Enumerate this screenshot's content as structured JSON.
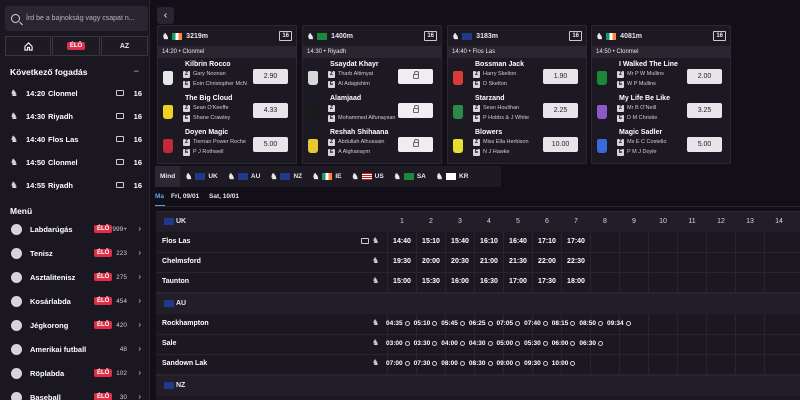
{
  "search": {
    "placeholder": "Írd be a bajnokság vagy csapat n..."
  },
  "segments": {
    "home": "home",
    "live": "ÉLŐ",
    "az": "AZ"
  },
  "next_bets": {
    "title": "Következő fogadás",
    "collapse": "−",
    "items": [
      {
        "time": "14:20",
        "track": "Clonmel",
        "count": "16",
        "icon": "tv-icon"
      },
      {
        "time": "14:30",
        "track": "Riyadh",
        "count": "16",
        "icon": "tv-icon"
      },
      {
        "time": "14:40",
        "track": "Flos Las",
        "count": "16",
        "icon": "tv-icon"
      },
      {
        "time": "14:50",
        "track": "Clonmel",
        "count": "16",
        "icon": "tv-icon"
      },
      {
        "time": "14:55",
        "track": "Riyadh",
        "count": "16",
        "icon": "tv-icon"
      }
    ]
  },
  "menu": {
    "title": "Menü",
    "items": [
      {
        "name": "Labdarúgás",
        "live": "ÉLŐ",
        "count": "999+"
      },
      {
        "name": "Tenisz",
        "live": "ÉLŐ",
        "count": "223"
      },
      {
        "name": "Asztalitenisz",
        "live": "ÉLŐ",
        "count": "275"
      },
      {
        "name": "Kosárlabda",
        "live": "ÉLŐ",
        "count": "454"
      },
      {
        "name": "Jégkorong",
        "live": "ÉLŐ",
        "count": "420"
      },
      {
        "name": "Amerikai futball",
        "live": "",
        "count": "48"
      },
      {
        "name": "Röplabda",
        "live": "ÉLŐ",
        "count": "102"
      },
      {
        "name": "Baseball",
        "live": "ÉLŐ",
        "count": "30"
      }
    ]
  },
  "cards": [
    {
      "distance": "3219m",
      "count": "16",
      "flag": "ie",
      "sub": "14:20 • Clonmel",
      "runners": [
        {
          "name": "Kilbrin Rocco",
          "z": "Gary Noonan",
          "e": "Eoin Christopher McN",
          "odds": "2.90",
          "silk": "#e8e8e8"
        },
        {
          "name": "The Big Cloud",
          "z": "Sean O'Keeffe",
          "e": "Shane Crawley",
          "odds": "4.33",
          "silk": "#f0d020"
        },
        {
          "name": "Doyen Magic",
          "z": "Tiernan Power Roche",
          "e": "P J Rothwell",
          "odds": "5.00",
          "silk": "#c02a3a"
        }
      ]
    },
    {
      "distance": "1400m",
      "count": "16",
      "flag": "sa",
      "sub": "14:30 • Riyadh",
      "runners": [
        {
          "name": "Ssaydat Khayr",
          "z": "Tharb Altimyat",
          "e": "Al Adagishim",
          "odds": "",
          "silk": "#d8d8d8"
        },
        {
          "name": "Alamjaad",
          "z": "",
          "e": "Mohammed Alfunaysan",
          "odds": "",
          "silk": "#1a1a1a"
        },
        {
          "name": "Reshah Shihaana",
          "z": "Abdullah Alhussain",
          "e": "A Alghanaym",
          "odds": "",
          "silk": "#e8c830"
        }
      ]
    },
    {
      "distance": "3183m",
      "count": "16",
      "flag": "uk",
      "sub": "14:40 • Flos Las",
      "runners": [
        {
          "name": "Bossman Jack",
          "z": "Harry Skelton",
          "e": "D Skelton",
          "odds": "1.90",
          "silk": "#d83a3a"
        },
        {
          "name": "Starzand",
          "z": "Sean Houlihan",
          "e": "P Hobbs & J White",
          "odds": "2.25",
          "silk": "#2a8a4a"
        },
        {
          "name": "Blowers",
          "z": "Miss Ella Herbison",
          "e": "N J Hawke",
          "odds": "10.00",
          "silk": "#e8e030"
        }
      ]
    },
    {
      "distance": "4081m",
      "count": "16",
      "flag": "ie",
      "sub": "14:50 • Clonmel",
      "runners": [
        {
          "name": "I Walked The Line",
          "z": "Mr P W Mullins",
          "e": "W P Mullins",
          "odds": "2.00",
          "silk": "#1a8a3a"
        },
        {
          "name": "My Life Be Like",
          "z": "Mr B O'Neill",
          "e": "D M Christie",
          "odds": "3.25",
          "silk": "#8a5ac8"
        },
        {
          "name": "Magic Sadler",
          "z": "Ms E C Costello",
          "e": "P M J Doyle",
          "odds": "5.00",
          "silk": "#3a6ad8"
        }
      ]
    }
  ],
  "tabs": [
    {
      "label": "Mind"
    },
    {
      "label": "UK"
    },
    {
      "label": "AU"
    },
    {
      "label": "NZ"
    },
    {
      "label": "IE"
    },
    {
      "label": "US"
    },
    {
      "label": "SA"
    },
    {
      "label": "KR"
    }
  ],
  "dates": {
    "today": "Ma",
    "d1": "Fri, 09/01",
    "d2": "Sat, 10/01"
  },
  "columns": [
    "1",
    "2",
    "3",
    "4",
    "5",
    "6",
    "7",
    "8",
    "9",
    "10",
    "11",
    "12",
    "13",
    "14"
  ],
  "groups": [
    {
      "name": "UK",
      "rows": [
        {
          "track": "Flos Las",
          "times": [
            "14:40",
            "15:10",
            "15:40",
            "16:10",
            "16:40",
            "17:10",
            "17:40"
          ],
          "tv": true
        },
        {
          "track": "Chelmsford",
          "times": [
            "19:30",
            "20:00",
            "20:30",
            "21:00",
            "21:30",
            "22:00",
            "22:30"
          ],
          "tv": false
        },
        {
          "track": "Taunton",
          "times": [
            "15:00",
            "15:30",
            "16:00",
            "16:30",
            "17:00",
            "17:30",
            "18:00"
          ],
          "tv": false
        }
      ]
    },
    {
      "name": "AU",
      "rows": [
        {
          "track": "Rockhampton",
          "times": [
            "04:35",
            "05:10",
            "05:45",
            "06:25",
            "07:05",
            "07:40",
            "08:15",
            "08:50",
            "09:34"
          ]
        },
        {
          "track": "Sale",
          "times": [
            "03:00",
            "03:30",
            "04:00",
            "04:30",
            "05:00",
            "05:30",
            "06:00",
            "06:30"
          ]
        },
        {
          "track": "Sandown Lak",
          "times": [
            "07:00",
            "07:30",
            "08:00",
            "08:30",
            "09:00",
            "09:30",
            "10:00"
          ]
        }
      ]
    },
    {
      "name": "NZ",
      "rows": []
    }
  ]
}
